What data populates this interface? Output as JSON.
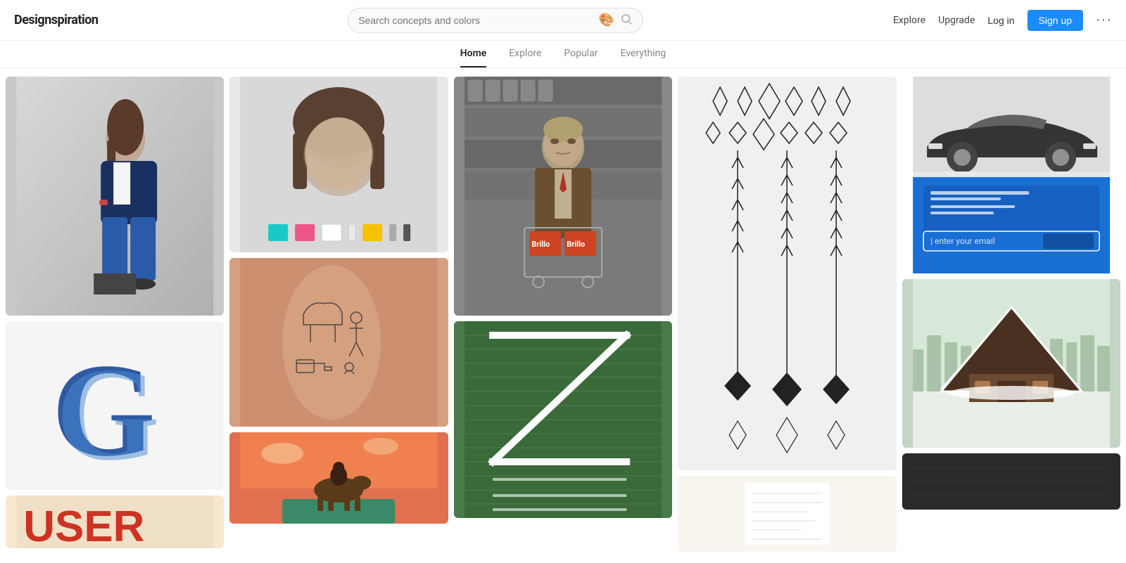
{
  "header": {
    "logo": "Designspiration",
    "search_placeholder": "Search concepts and colors",
    "nav_links": [
      "Explore",
      "Upgrade"
    ],
    "login_label": "Log in",
    "signup_label": "Sign up"
  },
  "nav_tabs": [
    {
      "label": "Home",
      "active": true
    },
    {
      "label": "Explore",
      "active": false
    },
    {
      "label": "Popular",
      "active": false
    },
    {
      "label": "Everything",
      "active": false
    }
  ],
  "swatches": [
    {
      "color": "#19c8c8"
    },
    {
      "color": "#ee5588"
    },
    {
      "color": "#ffffff"
    },
    {
      "color": "#f0f0f0"
    },
    {
      "color": "#f5c200"
    },
    {
      "color": "#aaaaaa"
    },
    {
      "color": "#555555"
    }
  ]
}
